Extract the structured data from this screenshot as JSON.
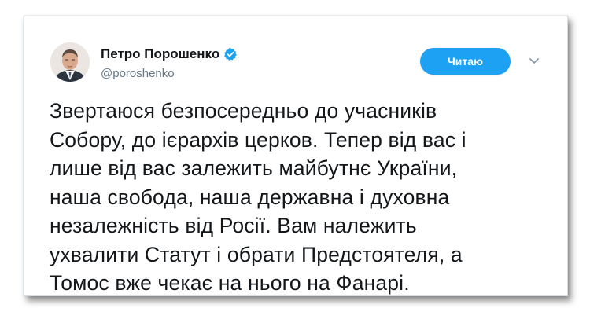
{
  "tweet": {
    "author_name": "Петро Порошенко",
    "author_handle": "@poroshenko",
    "follow_button_label": "Читаю",
    "text_lines": [
      "Звертаюся безпосередньо до учасників",
      "Собору, до ієрархів церков. Тепер від вас і",
      "лише від вас залежить майбутнє України,",
      "наша свобода, наша державна і духовна",
      "незалежність від Росії. Вам належить",
      "ухвалити Статут і обрати Предстоятеля, а",
      "Томос вже чекає на нього на Фанарі."
    ],
    "icons": {
      "verified": "verified-badge-icon",
      "menu": "chevron-down-icon",
      "avatar": "profile-photo"
    }
  },
  "colors": {
    "accent": "#1da1f2",
    "text": "#14171a",
    "secondary": "#657786"
  }
}
